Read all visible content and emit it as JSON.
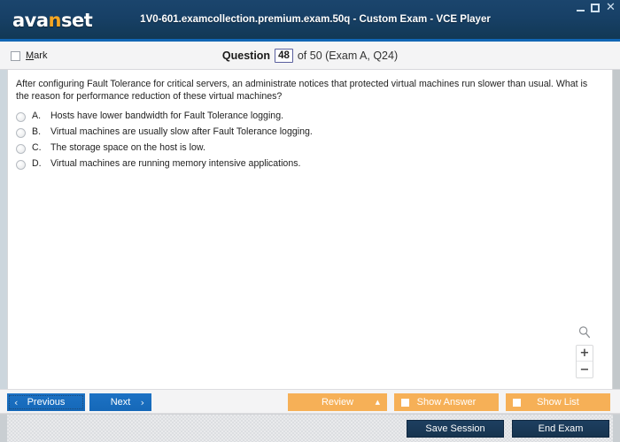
{
  "window": {
    "title": "1V0-601.examcollection.premium.exam.50q - Custom Exam - VCE Player",
    "logo_part1": "ava",
    "logo_accent": "n",
    "logo_part2": "set",
    "controls": {
      "minimize": "minimize-icon",
      "maximize": "maximize-icon",
      "close": "✕"
    }
  },
  "question_header": {
    "mark_label_prefix": "M",
    "mark_label_rest": "ark",
    "mark_checked": false,
    "question_word": "Question",
    "current_question": "48",
    "of_text": "of 50 (Exam A, Q24)"
  },
  "question": {
    "text": "After configuring Fault Tolerance for critical servers, an administrate notices that protected virtual machines run slower than usual. What is the reason for performance reduction of these virtual machines?",
    "options": [
      {
        "letter": "A.",
        "text": "Hosts have lower bandwidth for Fault Tolerance logging.",
        "selected": false
      },
      {
        "letter": "B.",
        "text": "Virtual machines are usually slow after Fault Tolerance logging.",
        "selected": false
      },
      {
        "letter": "C.",
        "text": "The storage space on the host is low.",
        "selected": false
      },
      {
        "letter": "D.",
        "text": "Virtual machines are running memory intensive applications.",
        "selected": false
      }
    ]
  },
  "zoom_widget": {
    "magnifier": "search-icon",
    "zoom_in": "+",
    "zoom_out": "−"
  },
  "toolbar": {
    "previous_label": "Previous",
    "previous_chevron": "‹",
    "next_label": "Next",
    "next_chevron": "›",
    "review_label": "Review",
    "review_arrow": "▲",
    "show_answer_label": "Show Answer",
    "show_list_label": "Show List"
  },
  "footer": {
    "save_session_label": "Save Session",
    "end_exam_label": "End Exam"
  },
  "colors": {
    "titlebar": "#17405f",
    "accent_line": "#1166b5",
    "logo_accent": "#f5a623",
    "button_blue": "#1568b8",
    "button_orange": "#f6b057",
    "footer_button": "#1d3f60"
  }
}
